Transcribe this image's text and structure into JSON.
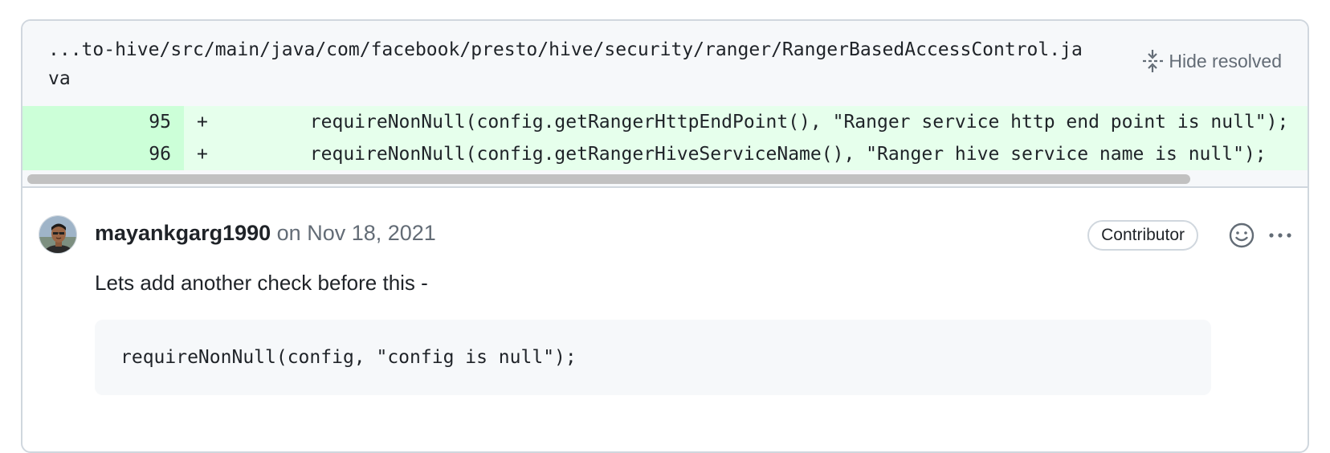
{
  "file": {
    "path": "...to-hive/src/main/java/com/facebook/presto/hive/security/ranger/RangerBasedAccessControl.java",
    "hide_resolved_label": "Hide resolved",
    "hide_resolved_icon": "fold-icon"
  },
  "diff": {
    "lines": [
      {
        "number": "95",
        "marker": "+",
        "code": "        requireNonNull(config.getRangerHttpEndPoint(), \"Ranger service http end point is null\");"
      },
      {
        "number": "96",
        "marker": "+",
        "code": "        requireNonNull(config.getRangerHiveServiceName(), \"Ranger hive service name is null\");"
      }
    ],
    "add_bg": "#e6ffec",
    "add_num_bg": "#ccffd8"
  },
  "comment": {
    "author": "mayankgarg1990",
    "timestamp": "on Nov 18, 2021",
    "role": "Contributor",
    "body": "Lets add another check before this -",
    "code": "requireNonNull(config, \"config is null\");",
    "reaction_icon": "smiley-icon",
    "more_icon": "kebab-horizontal-icon"
  },
  "colors": {
    "border": "#d0d7de",
    "muted_text": "#636c76",
    "header_bg": "#f6f8fa"
  }
}
